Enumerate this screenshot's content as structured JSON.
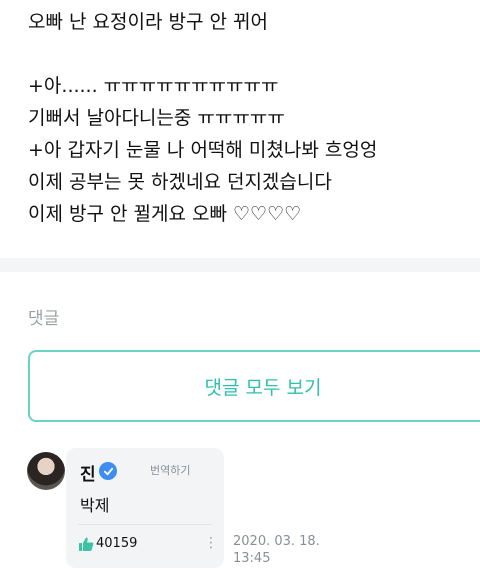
{
  "post": {
    "lines": [
      "오빠 난 요정이라 방구 안 뀌어",
      "",
      "+아...... ㅠㅠㅠㅠㅠㅠㅠㅠㅠㅠ",
      "기뻐서 날아다니는중 ㅠㅠㅠㅠㅠ",
      "+아 갑자기 눈물 나 어떡해 미쳤나봐 흐엉엉",
      "이제 공부는 못 하겠네요 던지겠습니다",
      "이제 방구 안 뀔게요 오빠 ♡♡♡♡"
    ]
  },
  "comments_section": {
    "label": "댓글",
    "view_all_button": "댓글 모두 보기"
  },
  "comment": {
    "author": "진",
    "verified": true,
    "translate_label": "번역하기",
    "text": "박제",
    "likes": "40159",
    "timestamp_date": "2020. 03. 18.",
    "timestamp_time": "13:45"
  },
  "colors": {
    "accent": "#2fbfae",
    "verified": "#3d8ef0",
    "like": "#3cc3a5"
  }
}
